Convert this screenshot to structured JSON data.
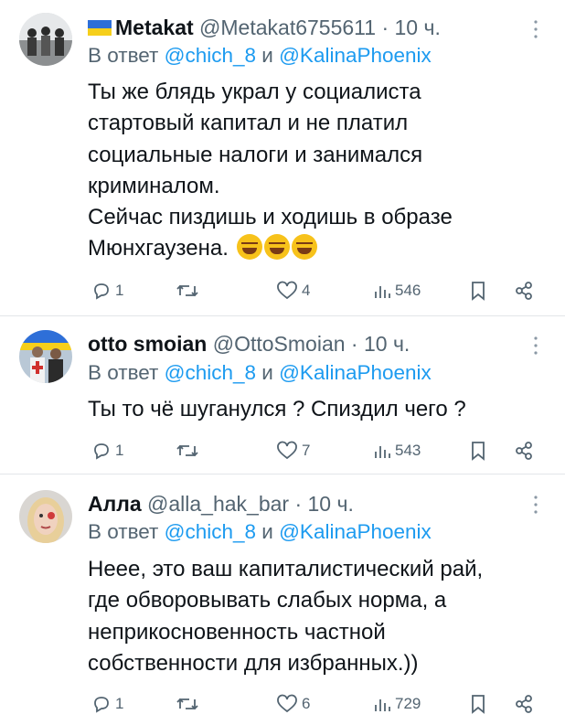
{
  "tweets": [
    {
      "name": "Metakat",
      "handle": "@Metakat6755611",
      "time": "· 10 ч.",
      "reply_prefix": "В ответ ",
      "reply_user1": "@chich_8",
      "reply_and": " и ",
      "reply_user2": "@KalinaPhoenix",
      "text": "Ты же блядь украл у социалиста\nстартовый капитал и не платил\nсоциальные налоги и занимался\nкриминалом.\nСейчас пиздишь и ходишь в образе\nМюнхгаузена. ",
      "emojis": [
        "rofl",
        "rofl",
        "rofl"
      ],
      "replies": "1",
      "retweets": "",
      "likes": "4",
      "views": "546",
      "has_flag": true
    },
    {
      "name": "otto smoian",
      "handle": "@OttoSmoian",
      "time": "· 10 ч.",
      "reply_prefix": "В ответ ",
      "reply_user1": "@chich_8",
      "reply_and": " и ",
      "reply_user2": "@KalinaPhoenix",
      "text": "Ты то чё шуганулся ? Спиздил чего ?",
      "replies": "1",
      "retweets": "",
      "likes": "7",
      "views": "543"
    },
    {
      "name": "Алла",
      "handle": "@alla_hak_bar",
      "time": "· 10 ч.",
      "reply_prefix": "В ответ ",
      "reply_user1": "@chich_8",
      "reply_and": " и ",
      "reply_user2": "@KalinaPhoenix",
      "text": "Неее, это ваш капиталистический рай,\nгде обворовывать слабых норма, а\nнеприкосновенность частной\nсобственности для избранных.))",
      "replies": "1",
      "retweets": "",
      "likes": "6",
      "views": "729"
    }
  ],
  "icons": {
    "reply": "reply-icon",
    "retweet": "retweet-icon",
    "like": "heart-icon",
    "views": "views-icon",
    "bookmark": "bookmark-icon",
    "share": "share-icon",
    "more": "more-icon"
  },
  "colors": {
    "link": "#1d9bf0",
    "secondary": "#536471",
    "text": "#0f1419",
    "flag_blue": "#2e6fd8",
    "flag_yellow": "#f6cf1b"
  }
}
